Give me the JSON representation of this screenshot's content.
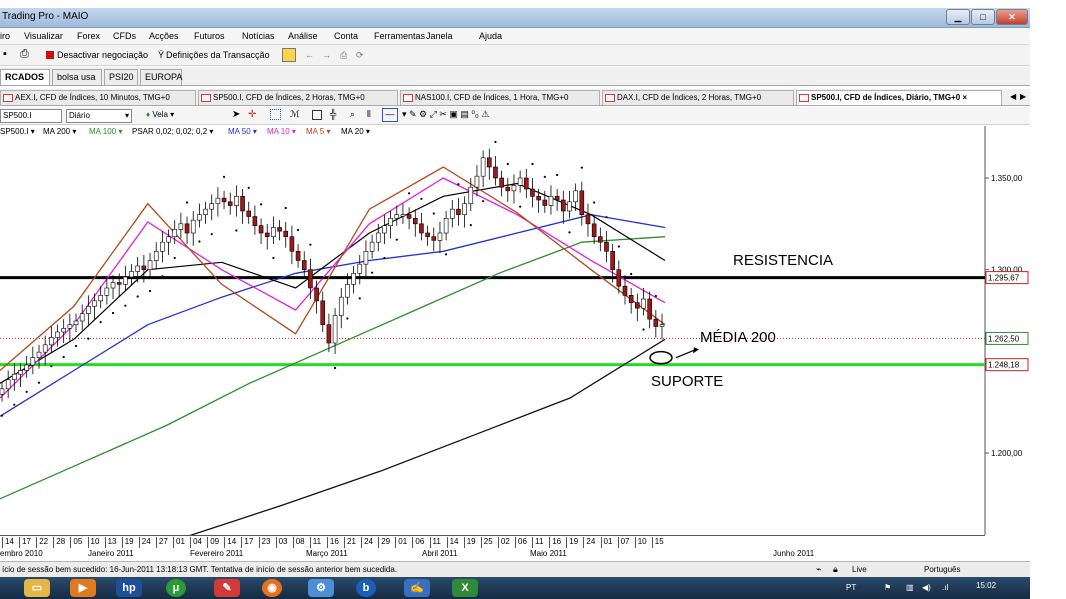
{
  "window": {
    "title": "Trading Pro - MAIO"
  },
  "menu": [
    "iro",
    "Visualizar",
    "Forex",
    "CFDs",
    "Acções",
    "Futuros",
    "Notícias",
    "Análise",
    "Conta",
    "Ferramentas",
    "Janela",
    "Ajuda"
  ],
  "toolbar": {
    "deactivate_label": "Desactivar negociação",
    "settings_label": "Definições da Transacção"
  },
  "workspace_tabs": [
    {
      "label": "RCADOS ×",
      "active": true
    },
    {
      "label": "bolsa usa",
      "active": false
    },
    {
      "label": "PSI20",
      "active": false
    },
    {
      "label": "EUROPA",
      "active": false
    }
  ],
  "chart_tabs": [
    {
      "label": "AEX.I, CFD de Índices, 10 Minutos, TMG+0",
      "active": false
    },
    {
      "label": "SP500.I, CFD de Índices, 2 Horas, TMG+0",
      "active": false
    },
    {
      "label": "NAS100.I, CFD de Índices, 1 Hora, TMG+0",
      "active": false
    },
    {
      "label": "DAX.I, CFD de Índices, 2 Horas, TMG+0",
      "active": false
    },
    {
      "label": "SP500.I, CFD de Índices, Diário, TMG+0 ×",
      "active": true
    }
  ],
  "chart_toolbar": {
    "symbol": "SP500.I",
    "period": "Diário",
    "style": "Vela"
  },
  "indicators": [
    {
      "label": "SP500.I ▾",
      "color": "#000000"
    },
    {
      "label": "MA 200 ▾",
      "color": "#000000"
    },
    {
      "label": "MA 100 ▾",
      "color": "#2e8b2e"
    },
    {
      "label": "PSAR 0,02; 0,02; 0,2 ▾",
      "color": "#000000"
    },
    {
      "label": "MA 50 ▾",
      "color": "#2233cc"
    },
    {
      "label": "MA 10 ▾",
      "color": "#e020e0"
    },
    {
      "label": "MA 5 ▾",
      "color": "#c04020"
    },
    {
      "label": "MA 20 ▾",
      "color": "#000000"
    }
  ],
  "price_axis": {
    "ticks": [
      "1.350,00",
      "1.300,00",
      "1.200,00"
    ],
    "markers": [
      {
        "label": "1.295,67",
        "color": "#cc2222"
      },
      {
        "label": "1.262,50",
        "color": "#2a8a2a"
      },
      {
        "label": "1.248,18",
        "color": "#cc2222"
      }
    ]
  },
  "annotations": {
    "resistance": "RESISTENCIA",
    "ma200": "MÉDIA 200",
    "support": "SUPORTE"
  },
  "date_axis": {
    "days": [
      "14",
      "17",
      "22",
      "28",
      "05",
      "10",
      "13",
      "19",
      "24",
      "27",
      "01",
      "04",
      "09",
      "14",
      "17",
      "23",
      "03",
      "08",
      "11",
      "16",
      "21",
      "24",
      "29",
      "01",
      "06",
      "11",
      "14",
      "19",
      "25",
      "02",
      "06",
      "11",
      "16",
      "19",
      "24",
      "01",
      "07",
      "10",
      "15"
    ],
    "months": [
      "embro 2010",
      "Janeiro 2011",
      "Fevereiro 2011",
      "Março 2011",
      "Abril 2011",
      "Maio 2011",
      "Junho 2011"
    ]
  },
  "status": {
    "message": "ício de sessão bem sucedido: 16-Jun-2011 13:18:13 GMT. Tentativa de início de sessão anterior bem sucedida.",
    "mode": "Live",
    "language": "Português"
  },
  "taskbar": {
    "lang": "PT",
    "time": "15:02"
  },
  "chart_data": {
    "type": "candlestick",
    "symbol": "SP500.I",
    "timeframe": "Diário",
    "y_unit": "index points",
    "ylim": [
      1170,
      1380
    ],
    "levels": [
      {
        "name": "RESISTENCIA",
        "value": 1295.67,
        "color": "#000000"
      },
      {
        "name": "SUPORTE",
        "value": 1248.18,
        "color": "#22dd22"
      },
      {
        "name": "MÉDIA 200",
        "value": 1262.5,
        "color": "#cc2222"
      }
    ],
    "close": [
      1235,
      1240,
      1243,
      1245,
      1248,
      1252,
      1255,
      1259,
      1263,
      1266,
      1268,
      1270,
      1272,
      1276,
      1280,
      1283,
      1286,
      1290,
      1293,
      1292,
      1296,
      1299,
      1302,
      1300,
      1305,
      1310,
      1315,
      1318,
      1322,
      1325,
      1320,
      1327,
      1330,
      1333,
      1336,
      1339,
      1337,
      1335,
      1340,
      1332,
      1329,
      1324,
      1320,
      1318,
      1323,
      1321,
      1318,
      1310,
      1305,
      1300,
      1290,
      1283,
      1270,
      1260,
      1275,
      1285,
      1292,
      1298,
      1303,
      1310,
      1315,
      1320,
      1324,
      1328,
      1330,
      1330,
      1328,
      1325,
      1320,
      1318,
      1316,
      1320,
      1328,
      1333,
      1330,
      1336,
      1345,
      1351,
      1361,
      1356,
      1350,
      1345,
      1343,
      1346,
      1350,
      1344,
      1340,
      1338,
      1335,
      1340,
      1338,
      1332,
      1337,
      1343,
      1330,
      1325,
      1318,
      1315,
      1310,
      1300,
      1291,
      1286,
      1282,
      1279,
      1284,
      1273,
      1269,
      1270
    ],
    "series": [
      {
        "name": "MA 200",
        "values": [
          1120,
          1137,
          1155,
          1172,
          1190,
          1210,
          1230,
          1262
        ]
      },
      {
        "name": "MA 100",
        "values": [
          1175,
          1195,
          1215,
          1238,
          1258,
          1278,
          1298,
          1315,
          1318
        ]
      },
      {
        "name": "MA 50",
        "values": [
          1220,
          1245,
          1270,
          1285,
          1298,
          1305,
          1310,
          1320,
          1330,
          1323
        ]
      },
      {
        "name": "MA 20",
        "values": [
          1238,
          1262,
          1300,
          1304,
          1290,
          1320,
          1340,
          1347,
          1330,
          1305
        ]
      },
      {
        "name": "MA 10",
        "values": [
          1230,
          1270,
          1326,
          1300,
          1278,
          1325,
          1350,
          1330,
          1305,
          1282
        ]
      },
      {
        "name": "MA 5",
        "values": [
          1245,
          1280,
          1336,
          1292,
          1265,
          1333,
          1356,
          1331,
          1300,
          1270
        ]
      }
    ]
  }
}
